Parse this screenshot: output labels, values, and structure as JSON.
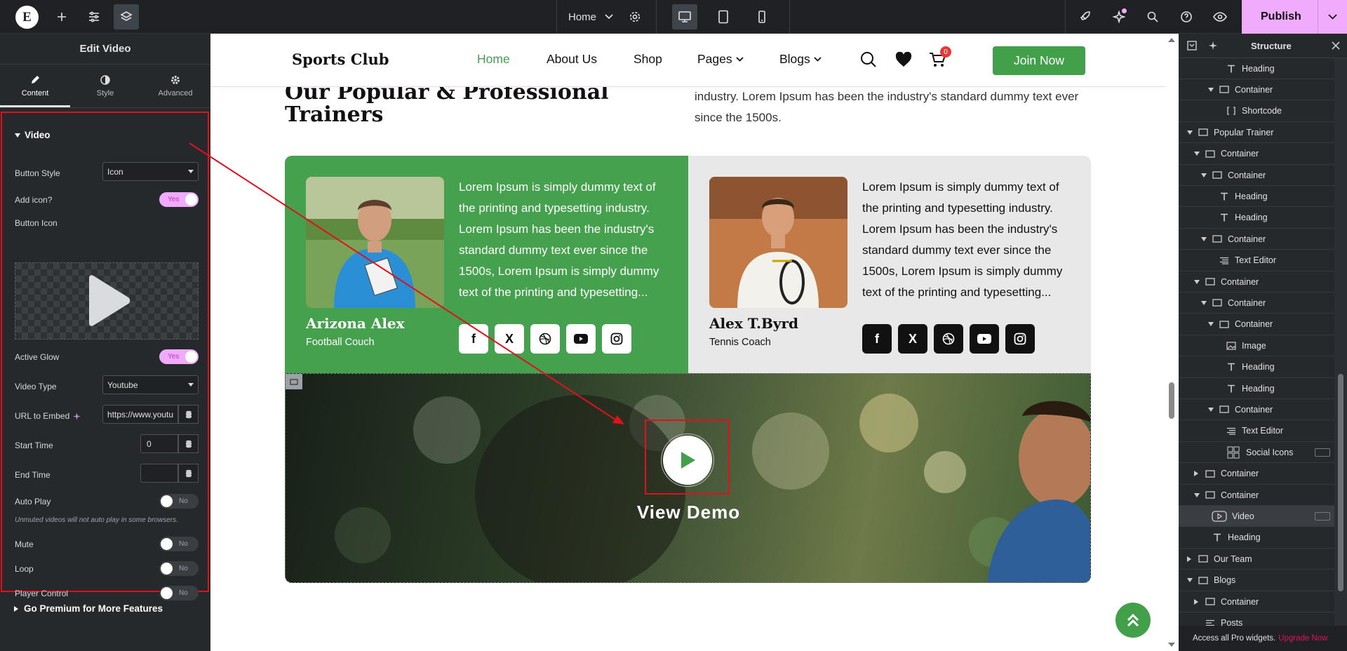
{
  "topbar": {
    "page_name": "Home",
    "publish_label": "Publish",
    "icons": [
      "elementor-logo-icon",
      "add-icon",
      "settings-sliders-icon",
      "layers-icon",
      "gear-icon",
      "desktop-icon",
      "tablet-icon",
      "mobile-icon",
      "rocket-icon",
      "ai-sparkle-icon",
      "search-icon",
      "help-icon",
      "eye-icon",
      "chevron-down-icon"
    ]
  },
  "left_panel": {
    "title": "Edit Video",
    "tabs": [
      {
        "label": "Content"
      },
      {
        "label": "Style"
      },
      {
        "label": "Advanced"
      }
    ],
    "section_title": "Video",
    "controls": {
      "button_style": {
        "label": "Button Style",
        "value": "Icon"
      },
      "add_icon": {
        "label": "Add icon?",
        "value": "Yes"
      },
      "button_icon": {
        "label": "Button Icon"
      },
      "active_glow": {
        "label": "Active Glow",
        "value": "Yes"
      },
      "video_type": {
        "label": "Video Type",
        "value": "Youtube"
      },
      "url_embed": {
        "label": "URL to Embed",
        "value": "https://www.youtul"
      },
      "start_time": {
        "label": "Start Time",
        "value": "0"
      },
      "end_time": {
        "label": "End Time",
        "value": ""
      },
      "auto_play": {
        "label": "Auto Play",
        "value": "No"
      },
      "auto_play_note": "Unmuted videos will not auto play in some browsers.",
      "mute": {
        "label": "Mute",
        "value": "No"
      },
      "loop": {
        "label": "Loop",
        "value": "No"
      },
      "player_control": {
        "label": "Player Control",
        "value": "No"
      }
    },
    "go_premium": "Go Premium for More Features"
  },
  "site": {
    "logo": "Sports Club",
    "nav": [
      {
        "label": "Home",
        "active": true
      },
      {
        "label": "About Us"
      },
      {
        "label": "Shop"
      },
      {
        "label": "Pages",
        "dropdown": true
      },
      {
        "label": "Blogs",
        "dropdown": true
      }
    ],
    "cart_count": "0",
    "join_label": "Join Now",
    "trainers_title": "Our Popular & Professional Trainers",
    "trainers_desc": "industry. Lorem Ipsum has been the industry's standard dummy text ever since the 1500s.",
    "trainers": [
      {
        "name": "Arizona Alex",
        "role": "Football Couch",
        "desc": "Lorem Ipsum is simply dummy text of the printing and typesetting industry. Lorem Ipsum has been the industry's standard dummy text ever since the 1500s, Lorem Ipsum is simply dummy text of the printing and typesetting..."
      },
      {
        "name": "Alex T.Byrd",
        "role": "Tennis Coach",
        "desc": "Lorem Ipsum is simply dummy text of the printing and typesetting industry. Lorem Ipsum has been the industry's standard dummy text ever since the 1500s, Lorem Ipsum is simply dummy text of the printing and typesetting..."
      }
    ],
    "social_icons": [
      "facebook-icon",
      "x-icon",
      "dribbble-icon",
      "youtube-icon",
      "instagram-icon"
    ],
    "video_label": "View Demo"
  },
  "structure": {
    "title": "Structure",
    "items": [
      {
        "label": "Heading",
        "type": "heading"
      },
      {
        "label": "Container",
        "type": "container",
        "open": true
      },
      {
        "label": "Shortcode",
        "type": "shortcode"
      },
      {
        "label": "Popular Trainer",
        "type": "container",
        "open": true
      },
      {
        "label": "Container",
        "type": "container",
        "open": true
      },
      {
        "label": "Container",
        "type": "container",
        "open": true
      },
      {
        "label": "Heading",
        "type": "heading"
      },
      {
        "label": "Heading",
        "type": "heading"
      },
      {
        "label": "Container",
        "type": "container",
        "open": true
      },
      {
        "label": "Text Editor",
        "type": "text"
      },
      {
        "label": "Container",
        "type": "container",
        "open": true
      },
      {
        "label": "Container",
        "type": "container",
        "open": true
      },
      {
        "label": "Container",
        "type": "container",
        "open": true
      },
      {
        "label": "Image",
        "type": "image"
      },
      {
        "label": "Heading",
        "type": "heading"
      },
      {
        "label": "Heading",
        "type": "heading"
      },
      {
        "label": "Container",
        "type": "container",
        "open": true
      },
      {
        "label": "Text Editor",
        "type": "text"
      },
      {
        "label": "Social Icons",
        "type": "social"
      },
      {
        "label": "Container",
        "type": "container",
        "open": false
      },
      {
        "label": "Container",
        "type": "container",
        "open": true
      },
      {
        "label": "Video",
        "type": "video",
        "selected": true
      },
      {
        "label": "Heading",
        "type": "heading"
      },
      {
        "label": "Our Team",
        "type": "container",
        "open": false
      },
      {
        "label": "Blogs",
        "type": "container",
        "open": true
      },
      {
        "label": "Container",
        "type": "container",
        "open": false
      },
      {
        "label": "Posts",
        "type": "posts"
      }
    ],
    "footer_text": "Access all Pro widgets.",
    "upgrade_label": "Upgrade Now"
  }
}
